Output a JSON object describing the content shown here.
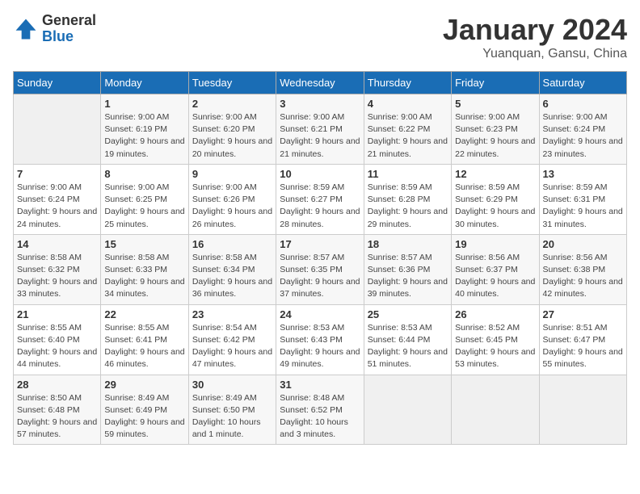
{
  "logo": {
    "general": "General",
    "blue": "Blue"
  },
  "title": "January 2024",
  "subtitle": "Yuanquan, Gansu, China",
  "weekdays": [
    "Sunday",
    "Monday",
    "Tuesday",
    "Wednesday",
    "Thursday",
    "Friday",
    "Saturday"
  ],
  "weeks": [
    [
      {
        "day": "",
        "sunrise": "",
        "sunset": "",
        "daylight": ""
      },
      {
        "day": "1",
        "sunrise": "Sunrise: 9:00 AM",
        "sunset": "Sunset: 6:19 PM",
        "daylight": "Daylight: 9 hours and 19 minutes."
      },
      {
        "day": "2",
        "sunrise": "Sunrise: 9:00 AM",
        "sunset": "Sunset: 6:20 PM",
        "daylight": "Daylight: 9 hours and 20 minutes."
      },
      {
        "day": "3",
        "sunrise": "Sunrise: 9:00 AM",
        "sunset": "Sunset: 6:21 PM",
        "daylight": "Daylight: 9 hours and 21 minutes."
      },
      {
        "day": "4",
        "sunrise": "Sunrise: 9:00 AM",
        "sunset": "Sunset: 6:22 PM",
        "daylight": "Daylight: 9 hours and 21 minutes."
      },
      {
        "day": "5",
        "sunrise": "Sunrise: 9:00 AM",
        "sunset": "Sunset: 6:23 PM",
        "daylight": "Daylight: 9 hours and 22 minutes."
      },
      {
        "day": "6",
        "sunrise": "Sunrise: 9:00 AM",
        "sunset": "Sunset: 6:24 PM",
        "daylight": "Daylight: 9 hours and 23 minutes."
      }
    ],
    [
      {
        "day": "7",
        "sunrise": "Sunrise: 9:00 AM",
        "sunset": "Sunset: 6:24 PM",
        "daylight": "Daylight: 9 hours and 24 minutes."
      },
      {
        "day": "8",
        "sunrise": "Sunrise: 9:00 AM",
        "sunset": "Sunset: 6:25 PM",
        "daylight": "Daylight: 9 hours and 25 minutes."
      },
      {
        "day": "9",
        "sunrise": "Sunrise: 9:00 AM",
        "sunset": "Sunset: 6:26 PM",
        "daylight": "Daylight: 9 hours and 26 minutes."
      },
      {
        "day": "10",
        "sunrise": "Sunrise: 8:59 AM",
        "sunset": "Sunset: 6:27 PM",
        "daylight": "Daylight: 9 hours and 28 minutes."
      },
      {
        "day": "11",
        "sunrise": "Sunrise: 8:59 AM",
        "sunset": "Sunset: 6:28 PM",
        "daylight": "Daylight: 9 hours and 29 minutes."
      },
      {
        "day": "12",
        "sunrise": "Sunrise: 8:59 AM",
        "sunset": "Sunset: 6:29 PM",
        "daylight": "Daylight: 9 hours and 30 minutes."
      },
      {
        "day": "13",
        "sunrise": "Sunrise: 8:59 AM",
        "sunset": "Sunset: 6:31 PM",
        "daylight": "Daylight: 9 hours and 31 minutes."
      }
    ],
    [
      {
        "day": "14",
        "sunrise": "Sunrise: 8:58 AM",
        "sunset": "Sunset: 6:32 PM",
        "daylight": "Daylight: 9 hours and 33 minutes."
      },
      {
        "day": "15",
        "sunrise": "Sunrise: 8:58 AM",
        "sunset": "Sunset: 6:33 PM",
        "daylight": "Daylight: 9 hours and 34 minutes."
      },
      {
        "day": "16",
        "sunrise": "Sunrise: 8:58 AM",
        "sunset": "Sunset: 6:34 PM",
        "daylight": "Daylight: 9 hours and 36 minutes."
      },
      {
        "day": "17",
        "sunrise": "Sunrise: 8:57 AM",
        "sunset": "Sunset: 6:35 PM",
        "daylight": "Daylight: 9 hours and 37 minutes."
      },
      {
        "day": "18",
        "sunrise": "Sunrise: 8:57 AM",
        "sunset": "Sunset: 6:36 PM",
        "daylight": "Daylight: 9 hours and 39 minutes."
      },
      {
        "day": "19",
        "sunrise": "Sunrise: 8:56 AM",
        "sunset": "Sunset: 6:37 PM",
        "daylight": "Daylight: 9 hours and 40 minutes."
      },
      {
        "day": "20",
        "sunrise": "Sunrise: 8:56 AM",
        "sunset": "Sunset: 6:38 PM",
        "daylight": "Daylight: 9 hours and 42 minutes."
      }
    ],
    [
      {
        "day": "21",
        "sunrise": "Sunrise: 8:55 AM",
        "sunset": "Sunset: 6:40 PM",
        "daylight": "Daylight: 9 hours and 44 minutes."
      },
      {
        "day": "22",
        "sunrise": "Sunrise: 8:55 AM",
        "sunset": "Sunset: 6:41 PM",
        "daylight": "Daylight: 9 hours and 46 minutes."
      },
      {
        "day": "23",
        "sunrise": "Sunrise: 8:54 AM",
        "sunset": "Sunset: 6:42 PM",
        "daylight": "Daylight: 9 hours and 47 minutes."
      },
      {
        "day": "24",
        "sunrise": "Sunrise: 8:53 AM",
        "sunset": "Sunset: 6:43 PM",
        "daylight": "Daylight: 9 hours and 49 minutes."
      },
      {
        "day": "25",
        "sunrise": "Sunrise: 8:53 AM",
        "sunset": "Sunset: 6:44 PM",
        "daylight": "Daylight: 9 hours and 51 minutes."
      },
      {
        "day": "26",
        "sunrise": "Sunrise: 8:52 AM",
        "sunset": "Sunset: 6:45 PM",
        "daylight": "Daylight: 9 hours and 53 minutes."
      },
      {
        "day": "27",
        "sunrise": "Sunrise: 8:51 AM",
        "sunset": "Sunset: 6:47 PM",
        "daylight": "Daylight: 9 hours and 55 minutes."
      }
    ],
    [
      {
        "day": "28",
        "sunrise": "Sunrise: 8:50 AM",
        "sunset": "Sunset: 6:48 PM",
        "daylight": "Daylight: 9 hours and 57 minutes."
      },
      {
        "day": "29",
        "sunrise": "Sunrise: 8:49 AM",
        "sunset": "Sunset: 6:49 PM",
        "daylight": "Daylight: 9 hours and 59 minutes."
      },
      {
        "day": "30",
        "sunrise": "Sunrise: 8:49 AM",
        "sunset": "Sunset: 6:50 PM",
        "daylight": "Daylight: 10 hours and 1 minute."
      },
      {
        "day": "31",
        "sunrise": "Sunrise: 8:48 AM",
        "sunset": "Sunset: 6:52 PM",
        "daylight": "Daylight: 10 hours and 3 minutes."
      },
      {
        "day": "",
        "sunrise": "",
        "sunset": "",
        "daylight": ""
      },
      {
        "day": "",
        "sunrise": "",
        "sunset": "",
        "daylight": ""
      },
      {
        "day": "",
        "sunrise": "",
        "sunset": "",
        "daylight": ""
      }
    ]
  ]
}
